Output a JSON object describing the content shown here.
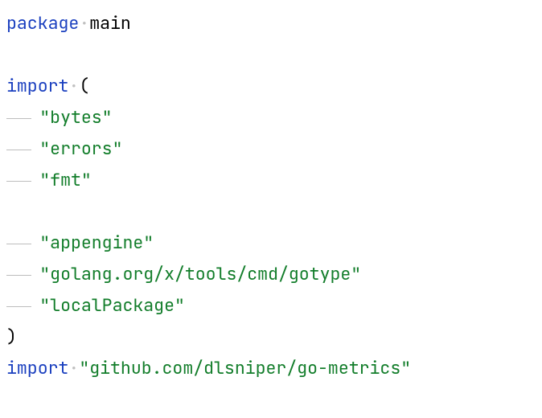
{
  "code": {
    "package_kw": "package",
    "package_name": "main",
    "import_kw": "import",
    "open_paren": "(",
    "close_paren": ")",
    "imports_block": [
      "\"bytes\"",
      "\"errors\"",
      "\"fmt\"",
      "",
      "\"appengine\"",
      "\"golang.org/x/tools/cmd/gotype\"",
      "\"localPackage\""
    ],
    "single_import": "\"github.com/dlsniper/go-metrics\""
  }
}
